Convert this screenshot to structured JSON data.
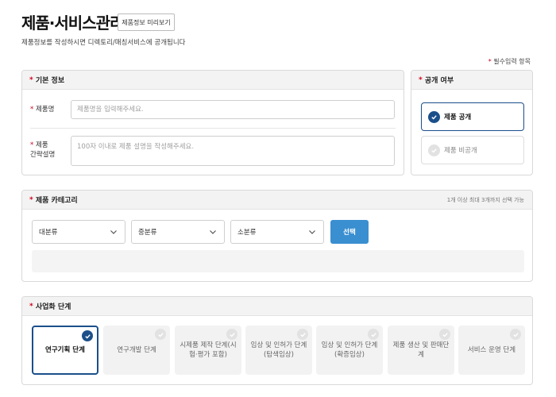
{
  "header": {
    "title": "제품·서비스관리",
    "preview_button": "제품정보 미리보기",
    "subtitle": "제품정보를 작성하시면 디렉토리/매칭서비스에 공개됩니다",
    "required_note": "필수입력 항목",
    "required_mark": "*"
  },
  "basic_info": {
    "title": "기본 정보",
    "name_label": "제품명",
    "name_placeholder": "제품명을 입력해주세요.",
    "desc_label_1": "제품",
    "desc_label_2": "간략설명",
    "desc_placeholder": "100자 이내로 제품 설명을 작성해주세요."
  },
  "visibility": {
    "title": "공개 여부",
    "options": [
      {
        "label": "제품 공개",
        "selected": true
      },
      {
        "label": "제품 비공개",
        "selected": false
      }
    ]
  },
  "category": {
    "title": "제품 카테고리",
    "hint": "1개 이상 최대 3개까지 선택 가능",
    "selects": [
      "대분류",
      "중분류",
      "소분류"
    ],
    "select_button": "선택"
  },
  "stage": {
    "title": "사업화 단계",
    "items": [
      {
        "label": "연구기획 단계",
        "selected": true
      },
      {
        "label": "연구개발 단계",
        "selected": false
      },
      {
        "label": "시제품 제작 단계(시험·평가 포함)",
        "selected": false
      },
      {
        "label": "임상 및 인허가 단계(탐색임상)",
        "selected": false
      },
      {
        "label": "임상 및 인허가 단계(확증임상)",
        "selected": false
      },
      {
        "label": "제품 생산 및 판매단계",
        "selected": false
      },
      {
        "label": "서비스 운영 단계",
        "selected": false
      }
    ]
  },
  "colors": {
    "accent": "#1b4f8a",
    "button": "#3a8fd0",
    "required": "#d0021b"
  },
  "icons": {
    "check": "check-icon",
    "chevron": "chevron-down-icon"
  }
}
